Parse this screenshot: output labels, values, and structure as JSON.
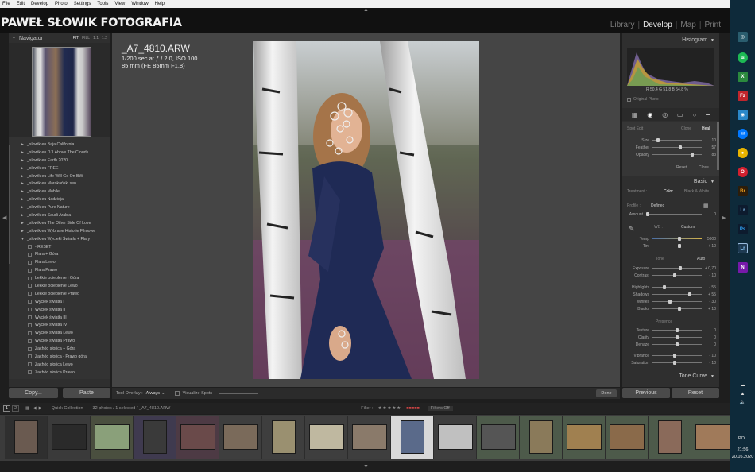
{
  "menu": [
    "File",
    "Edit",
    "Develop",
    "Photo",
    "Settings",
    "Tools",
    "View",
    "Window",
    "Help"
  ],
  "identity_plate": "PAWEŁ SŁOWIK FOTOGRAFIA",
  "modules": [
    {
      "label": "Library",
      "active": false
    },
    {
      "label": "Develop",
      "active": true
    },
    {
      "label": "Map",
      "active": false
    },
    {
      "label": "Print",
      "active": false
    }
  ],
  "navigator": {
    "title": "Navigator",
    "options": [
      "FIT",
      "FILL",
      "1:1",
      "1:2"
    ],
    "selected": "FIT"
  },
  "presets": [
    {
      "label": "_slowik.eu Baja California",
      "child": false
    },
    {
      "label": "_slowik.eu DJI Above The Clouds",
      "child": false
    },
    {
      "label": "_slowik.eu Earth 2020",
      "child": false
    },
    {
      "label": "_slowik.eu FREE",
      "child": false
    },
    {
      "label": "_slowik.eu Life Will Go On BW",
      "child": false
    },
    {
      "label": "_slowik.eu Marokański sen",
      "child": false
    },
    {
      "label": "_slowik.eu Mobile",
      "child": false
    },
    {
      "label": "_slowik.eu Nadzieja",
      "child": false
    },
    {
      "label": "_slowik.eu Pure Nature",
      "child": false
    },
    {
      "label": "_slowik.eu Saudi Arabia",
      "child": false
    },
    {
      "label": "_slowik.eu The Other Side Of Love",
      "child": false
    },
    {
      "label": "_slowik.eu Wybrane Historie Filmowe",
      "child": false
    },
    {
      "label": "_slowik.eu Wycieki Światła + Flary",
      "child": false,
      "open": true
    },
    {
      "label": "- RESET",
      "child": true
    },
    {
      "label": "Flara + Góra",
      "child": true
    },
    {
      "label": "Flara Lewo",
      "child": true
    },
    {
      "label": "Flara Prawo",
      "child": true
    },
    {
      "label": "Lekkie ocieplenie i Góra",
      "child": true
    },
    {
      "label": "Lekkie ocieplenie Lewo",
      "child": true
    },
    {
      "label": "Lekkie ocieplenie Prawo",
      "child": true
    },
    {
      "label": "Wyciek światła I",
      "child": true
    },
    {
      "label": "Wyciek światła II",
      "child": true
    },
    {
      "label": "Wyciek światła III",
      "child": true
    },
    {
      "label": "Wyciek światła IV",
      "child": true
    },
    {
      "label": "Wyciek światła Lewo",
      "child": true
    },
    {
      "label": "Wyciek światła Prawo",
      "child": true
    },
    {
      "label": "Zachód słońca + Góra",
      "child": true
    },
    {
      "label": "Zachód słońca - Prawo góra",
      "child": true
    },
    {
      "label": "Zachód słońca Lewo",
      "child": true
    },
    {
      "label": "Zachód słońca Prawo",
      "child": true
    }
  ],
  "left_buttons": {
    "copy": "Copy...",
    "paste": "Paste"
  },
  "photo_info": {
    "filename": "_A7_4810.ARW",
    "exposure": "1/200 sec at ƒ / 2,0, ISO 100",
    "lens": "85 mm (FE 85mm F1.8)"
  },
  "toolbar": {
    "tool_overlay_label": "Tool Overlay :",
    "tool_overlay_value": "Always",
    "visualize_spots": "Visualize Spots",
    "done": "Done"
  },
  "histogram": {
    "title": "Histogram",
    "readout": "R  50,4   G  51,8   B  54,8  %",
    "original_photo": "Original Photo"
  },
  "spot_edit": {
    "label": "Spot Edit :",
    "clone": "Clone",
    "heal": "Heal",
    "active": "Heal",
    "sliders": [
      {
        "label": "Size",
        "value": "10",
        "level": 0.08
      },
      {
        "label": "Feather",
        "value": "57",
        "level": 0.57
      },
      {
        "label": "Opacity",
        "value": "83",
        "level": 0.83
      }
    ],
    "reset": "Reset",
    "close": "Close"
  },
  "basic": {
    "title": "Basic",
    "treatment_label": "Treatment :",
    "color": "Color",
    "bw": "Black & White",
    "profile_label": "Profile :",
    "profile_value": "Defined",
    "amount_label": "Amount",
    "amount_value": "0",
    "wb_label": "WB :",
    "wb_value": "Custom",
    "temp": {
      "label": "Temp",
      "value": "5600",
      "level": 0.55
    },
    "tint": {
      "label": "Tint",
      "value": "+ 10",
      "level": 0.55
    },
    "tone_label": "Tone",
    "auto": "Auto",
    "tone": [
      {
        "label": "Exposure",
        "value": "+ 0,70",
        "level": 0.57
      },
      {
        "label": "Contrast",
        "value": "- 10",
        "level": 0.45
      },
      {
        "label": "Highlights",
        "value": "- 55",
        "level": 0.22
      },
      {
        "label": "Shadows",
        "value": "+ 55",
        "level": 0.78
      },
      {
        "label": "Whites",
        "value": "- 30",
        "level": 0.35
      },
      {
        "label": "Blacks",
        "value": "+ 10",
        "level": 0.55
      }
    ],
    "presence_label": "Presence",
    "presence": [
      {
        "label": "Texture",
        "value": "0",
        "level": 0.5
      },
      {
        "label": "Clarity",
        "value": "0",
        "level": 0.5
      },
      {
        "label": "Dehaze",
        "value": "0",
        "level": 0.5
      },
      {
        "label": "Vibrance",
        "value": "- 10",
        "level": 0.45
      },
      {
        "label": "Saturation",
        "value": "- 10",
        "level": 0.45
      }
    ]
  },
  "tone_curve": "Tone Curve",
  "right_buttons": {
    "previous": "Previous",
    "reset": "Reset"
  },
  "filmstrip_bar": {
    "pages": [
      "1",
      "2"
    ],
    "source": "Quick Collection",
    "count": "32 photos / 1 selected / _A7_4810.ARW",
    "filter_label": "Filter :",
    "filters_off": "Filters Off"
  },
  "clock": {
    "lang": "POL",
    "time": "21:56",
    "date": "20.05.2020"
  }
}
